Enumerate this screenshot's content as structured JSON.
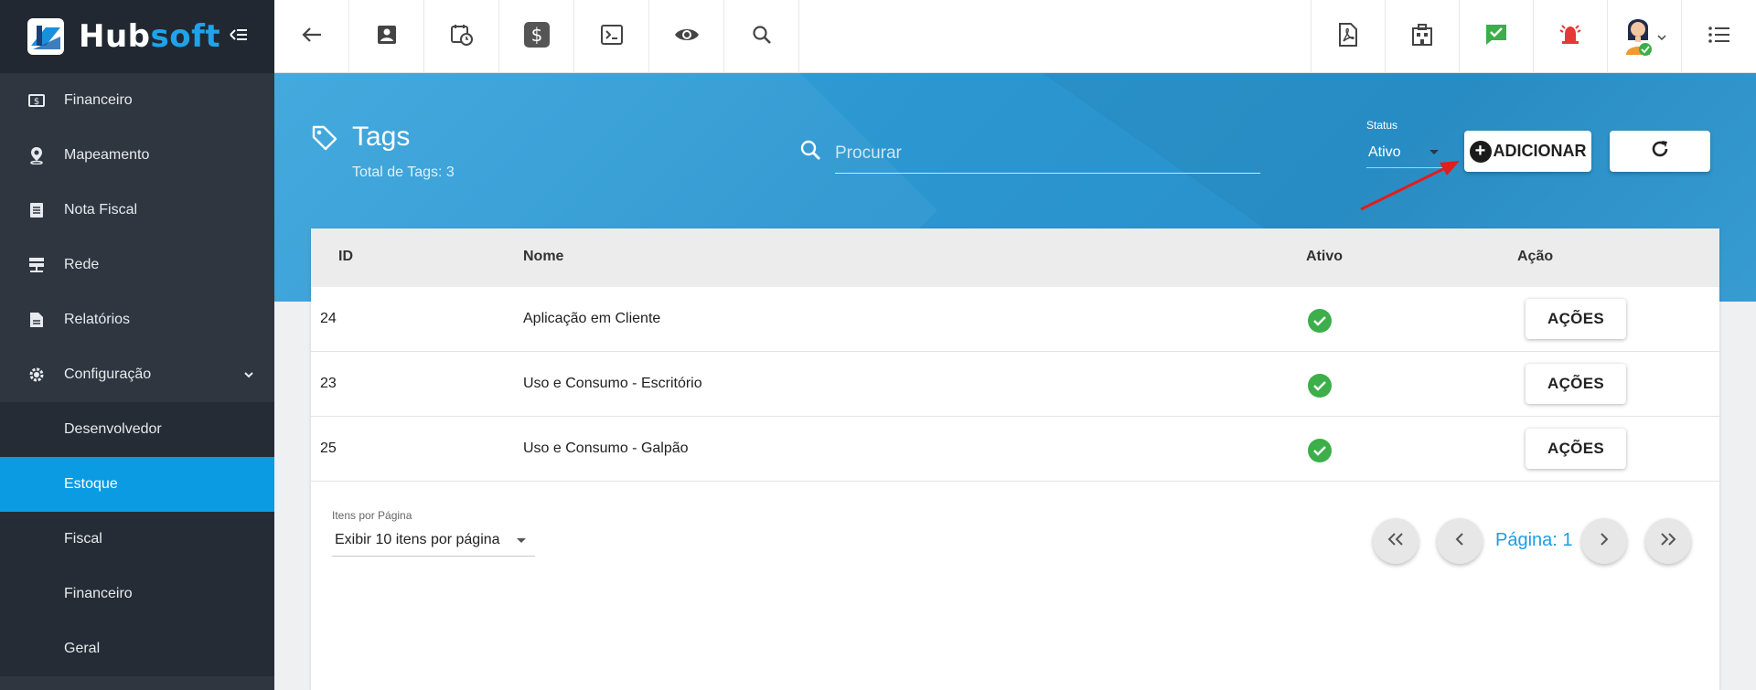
{
  "brand": {
    "name_prefix": "Hub",
    "name_suffix": "soft"
  },
  "sidebar": {
    "items": [
      {
        "label": "Financeiro",
        "icon": "money-icon"
      },
      {
        "label": "Mapeamento",
        "icon": "map-pin-icon"
      },
      {
        "label": "Nota Fiscal",
        "icon": "document-icon"
      },
      {
        "label": "Rede",
        "icon": "network-icon"
      },
      {
        "label": "Relatórios",
        "icon": "report-icon"
      },
      {
        "label": "Configuração",
        "icon": "gear-icon",
        "expanded": true
      }
    ],
    "sub_items": [
      {
        "label": "Desenvolvedor",
        "active": false
      },
      {
        "label": "Estoque",
        "active": true
      },
      {
        "label": "Fiscal",
        "active": false
      },
      {
        "label": "Financeiro",
        "active": false
      },
      {
        "label": "Geral",
        "active": false
      }
    ]
  },
  "topbar": {
    "icons": [
      "back-arrow-icon",
      "contact-icon",
      "schedule-icon",
      "dollar-icon",
      "terminal-icon",
      "eye-icon",
      "search-icon",
      "pdf-icon",
      "building-icon",
      "task-check-icon",
      "alarm-icon",
      "user-avatar",
      "menu-list-icon"
    ]
  },
  "header": {
    "title": "Tags",
    "subtitle": "Total de Tags: 3",
    "search_placeholder": "Procurar",
    "status_label": "Status",
    "status_value": "Ativo",
    "add_button": "ADICIONAR"
  },
  "table": {
    "columns": {
      "id": "ID",
      "name": "Nome",
      "active": "Ativo",
      "action": "Ação"
    },
    "action_label": "AÇÕES",
    "rows": [
      {
        "id": "24",
        "name": "Aplicação em Cliente",
        "active": true
      },
      {
        "id": "23",
        "name": "Uso e Consumo - Escritório",
        "active": true
      },
      {
        "id": "25",
        "name": "Uso e Consumo - Galpão",
        "active": true
      }
    ]
  },
  "pagination": {
    "per_page_label": "Itens por Página",
    "per_page_value": "Exibir 10 itens por página",
    "page_text": "Página: 1"
  },
  "colors": {
    "sidebar_bg": "#2f3640",
    "active_item": "#0a9be3",
    "header_blue": "#2b96d0",
    "success_green": "#3cae4a",
    "alarm_red": "#e53935",
    "annotation_arrow": "#e11d1d"
  }
}
